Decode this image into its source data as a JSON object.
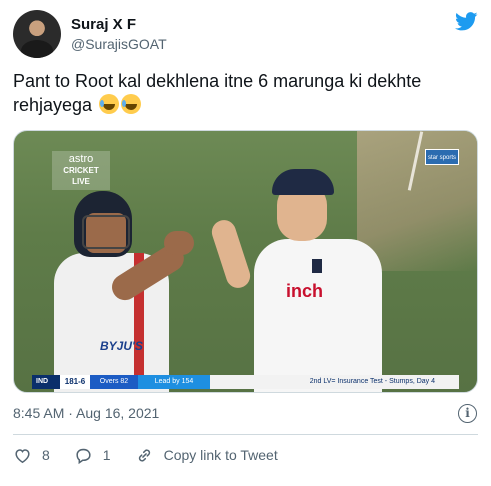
{
  "author": {
    "display_name": "Suraj X F",
    "handle": "@SurajisGOAT",
    "avatar_icon": "avatar-photo"
  },
  "platform_icon": "twitter-bird-icon",
  "tweet": {
    "text": "Pant to Root kal dekhlena itne 6 marunga ki dekhte rehjayega"
  },
  "media": {
    "broadcaster": {
      "line1": "astro",
      "line2": "CRICKET",
      "line3": "LIVE"
    },
    "channel_logo": "star sports",
    "scoreboard": {
      "team": "IND",
      "score": "181-6",
      "overs": "Overs 82",
      "lead": "Lead by 154",
      "match": "2nd LV= Insurance Test - Stumps, Day 4"
    },
    "shirt_logo_left": "BYJU'S",
    "shirt_logo_right": "inch"
  },
  "timestamp": "8:45 AM · Aug 16, 2021",
  "actions": {
    "likes": "8",
    "replies": "1",
    "copy_link": "Copy link to Tweet"
  },
  "colors": {
    "text_primary": "#0f1419",
    "text_secondary": "#536471",
    "twitter_blue": "#1d9bf0",
    "like_red": "#f91880",
    "border": "#cfd9de"
  }
}
